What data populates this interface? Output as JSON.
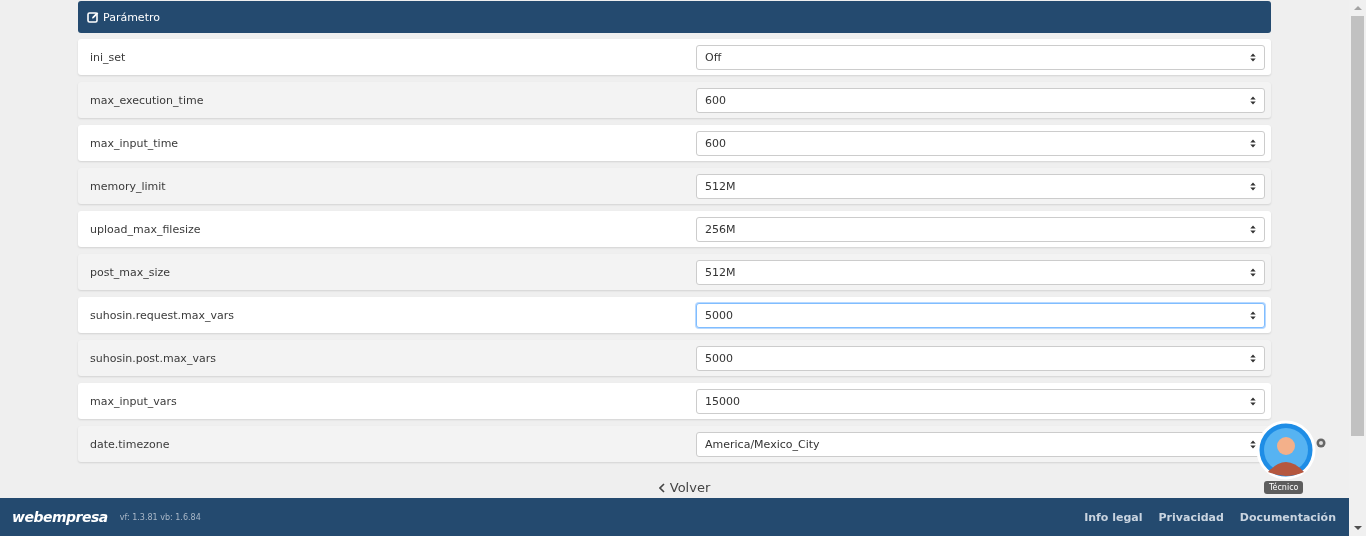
{
  "panel": {
    "title": "Parámetro"
  },
  "rows": [
    {
      "label": "ini_set",
      "value": "Off",
      "focused": false
    },
    {
      "label": "max_execution_time",
      "value": "600",
      "focused": false
    },
    {
      "label": "max_input_time",
      "value": "600",
      "focused": false
    },
    {
      "label": "memory_limit",
      "value": "512M",
      "focused": false
    },
    {
      "label": "upload_max_filesize",
      "value": "256M",
      "focused": false
    },
    {
      "label": "post_max_size",
      "value": "512M",
      "focused": false
    },
    {
      "label": "suhosin.request.max_vars",
      "value": "5000",
      "focused": true
    },
    {
      "label": "suhosin.post.max_vars",
      "value": "5000",
      "focused": false
    },
    {
      "label": "max_input_vars",
      "value": "15000",
      "focused": false
    },
    {
      "label": "date.timezone",
      "value": "America/Mexico_City",
      "focused": false
    }
  ],
  "back_link": "Volver",
  "support": {
    "label": "Técnico"
  },
  "footer": {
    "logo": "webempresa",
    "version": "vf: 1.3.81 vb: 1.6.84",
    "links": [
      "Info legal",
      "Privacidad",
      "Documentación"
    ]
  }
}
